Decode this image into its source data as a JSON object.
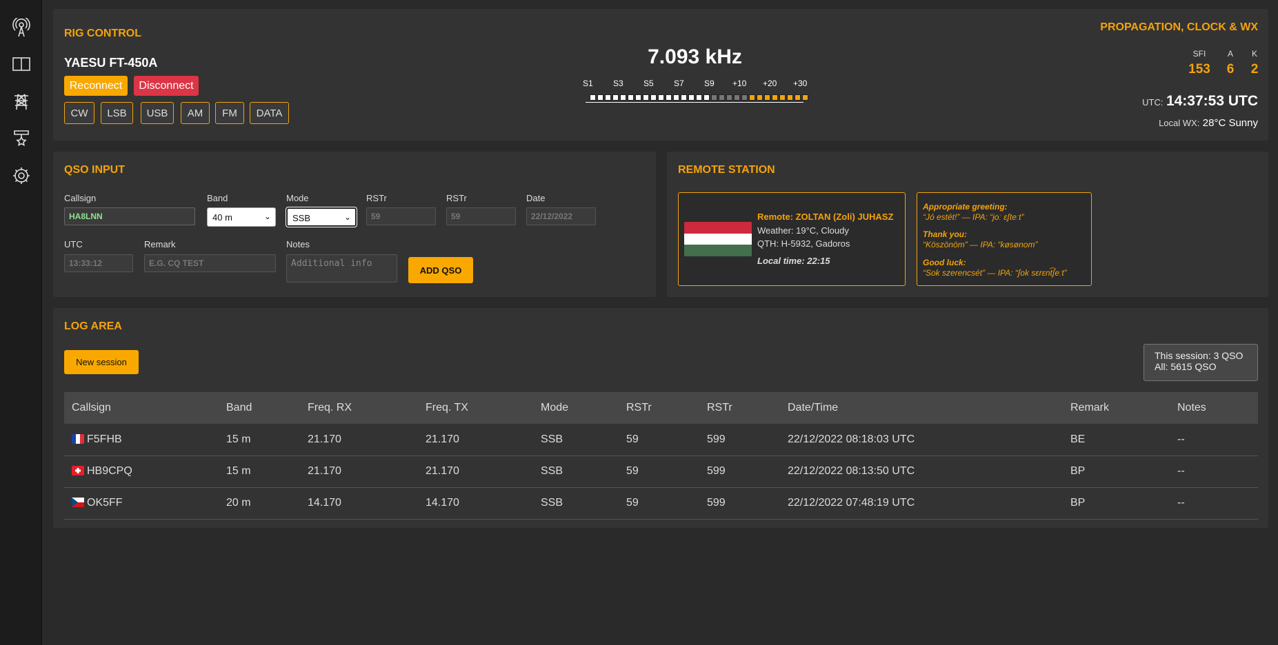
{
  "sidebar": {
    "icons": [
      "antenna-icon",
      "book-icon",
      "tower-icon",
      "award-icon",
      "settings-icon"
    ]
  },
  "rig": {
    "title": "RIG CONTROL",
    "radio_name": "YAESU FT-450A",
    "reconnect_label": "Reconnect",
    "disconnect_label": "Disconnect",
    "modes": [
      "CW",
      "LSB",
      "USB",
      "AM",
      "FM",
      "DATA"
    ],
    "frequency": "7.093 kHz",
    "meter_labels": [
      "S1",
      "S3",
      "S5",
      "S7",
      "S9",
      "+10",
      "+20",
      "+30"
    ],
    "meter": {
      "white": 16,
      "gray": 5,
      "orange": 8
    }
  },
  "propagation": {
    "title": "PROPAGATION, CLOCK & WX",
    "sfi_label": "SFI",
    "sfi": "153",
    "a_label": "A",
    "a": "6",
    "k_label": "K",
    "k": "2",
    "utc_label": "UTC:",
    "utc_time": "14:37:53 UTC",
    "wx_label": "Local WX:",
    "wx": "28°C Sunny"
  },
  "qso": {
    "title": "QSO INPUT",
    "callsign_label": "Callsign",
    "callsign": "HA8LNN",
    "band_label": "Band",
    "band": "40 m",
    "mode_label": "Mode",
    "mode": "SSB",
    "rst1_label": "RSTr",
    "rst1_placeholder": "59",
    "rst2_label": "RSTr",
    "rst2_placeholder": "59",
    "date_label": "Date",
    "date_placeholder": "22/12/2022",
    "utc_label": "UTC",
    "utc_placeholder": "13:33:12",
    "remark_label": "Remark",
    "remark_placeholder": "E.G. CQ TEST",
    "notes_label": "Notes",
    "notes_placeholder": "Additional info",
    "add_label": "ADD QSO"
  },
  "remote": {
    "title": "REMOTE STATION",
    "name": "Remote: ZOLTAN (Zoli) JUHASZ",
    "weather": "Weather: 19°C, Cloudy",
    "qth": "QTH: H-5932, Gadoros",
    "local_time": "Local time: 22:15",
    "phrases": [
      {
        "title": "Appropriate greeting:",
        "text": "“Jó estét!” — IPA: “joː ɛʃteːt”"
      },
      {
        "title": "Thank you:",
        "text": "“Köszönöm” — IPA: “køsønom”"
      },
      {
        "title": "Good luck:",
        "text": "“Sok szerencsét” — IPA: “ʃok sɛrɛnt͡ʃeːt”"
      }
    ],
    "colors": {
      "flag_red": "#cd2a3e",
      "flag_white": "#ffffff",
      "flag_green": "#436f4d"
    }
  },
  "log": {
    "title": "LOG AREA",
    "new_session_label": "New session",
    "session_count": "This session: 3 QSO",
    "all_count": "All: 5615 QSO",
    "columns": [
      "Callsign",
      "Band",
      "Freq. RX",
      "Freq. TX",
      "Mode",
      "RSTr",
      "RSTr",
      "Date/Time",
      "Remark",
      "Notes"
    ],
    "rows": [
      {
        "flag": "france-flag-icon",
        "cells": [
          "F5FHB",
          "15 m",
          "21.170",
          "21.170",
          "SSB",
          "59",
          "599",
          "22/12/2022 08:18:03 UTC",
          "BE",
          "--"
        ]
      },
      {
        "flag": "switzerland-flag-icon",
        "cells": [
          "HB9CPQ",
          "15 m",
          "21.170",
          "21.170",
          "SSB",
          "59",
          "599",
          "22/12/2022 08:13:50 UTC",
          "BP",
          "--"
        ]
      },
      {
        "flag": "czech-flag-icon",
        "cells": [
          "OK5FF",
          "20 m",
          "14.170",
          "14.170",
          "SSB",
          "59",
          "599",
          "22/12/2022 07:48:19 UTC",
          "BP",
          "--"
        ]
      }
    ]
  },
  "colors": {
    "accent": "#f5a30b",
    "danger": "#dc3545",
    "panel": "#333333",
    "background": "#2a2a2a"
  }
}
